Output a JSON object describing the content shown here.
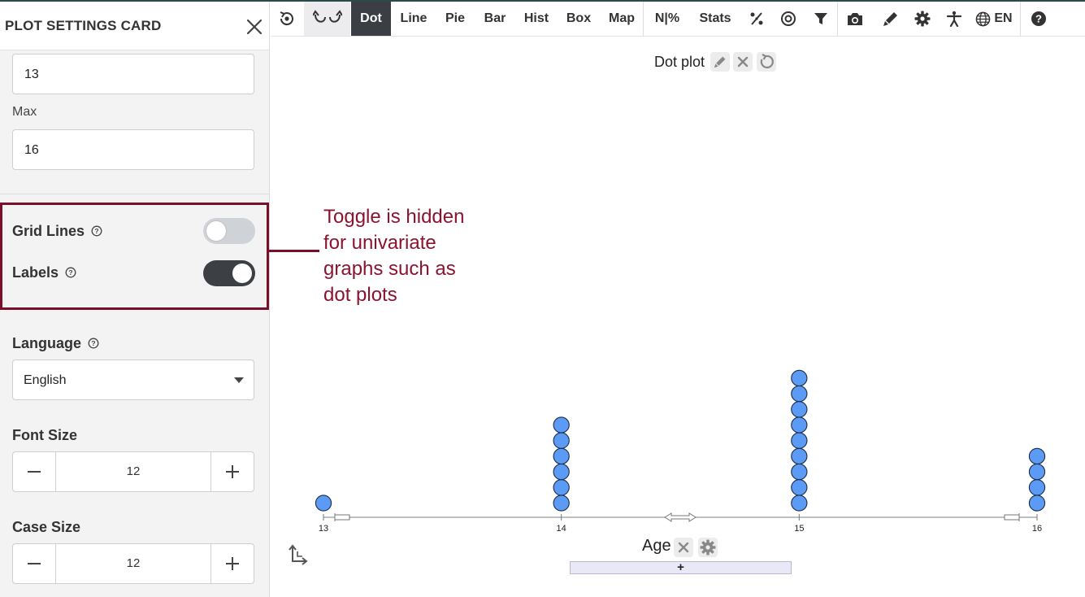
{
  "panel": {
    "title": "PLOT SETTINGS CARD",
    "min_value": "13",
    "max_label": "Max",
    "max_value": "16",
    "grid_lines_label": "Grid Lines",
    "grid_lines_on": false,
    "labels_label": "Labels",
    "labels_on": true,
    "language_label": "Language",
    "language_value": "English",
    "font_size_label": "Font Size",
    "font_size_value": "12",
    "case_size_label": "Case Size",
    "case_size_value": "12"
  },
  "toolbar": {
    "dot": "Dot",
    "line": "Line",
    "pie": "Pie",
    "bar": "Bar",
    "hist": "Hist",
    "box": "Box",
    "map": "Map",
    "n_percent": "N|%",
    "stats": "Stats",
    "language": "EN",
    "active": "Dot"
  },
  "plot": {
    "title": "Dot plot",
    "annotation": [
      "Toggle is hidden",
      "for univariate",
      "graphs such as",
      "dot plots"
    ],
    "add_label": "+"
  },
  "colors": {
    "dot_fill": "#5b9bf5",
    "highlight": "#7a0f2a",
    "annotation_text": "#8a1430",
    "active_tab": "#3b3f44"
  },
  "chart_data": {
    "type": "dot",
    "xlabel": "Age",
    "xlim": [
      13,
      16
    ],
    "ticks": [
      13,
      14,
      15,
      16
    ],
    "tick_labels": [
      "13",
      "14",
      "15",
      "16"
    ],
    "categories": [
      13,
      14,
      15,
      16
    ],
    "counts": [
      1,
      6,
      9,
      4
    ]
  }
}
